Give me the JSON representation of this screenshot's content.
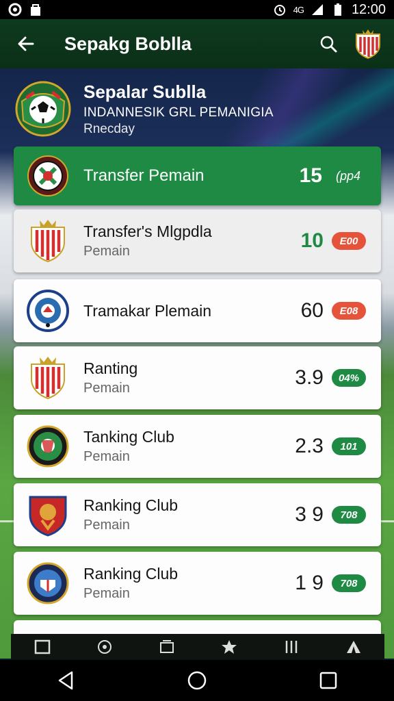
{
  "status_bar": {
    "time": "12:00",
    "network_label": "4G"
  },
  "app_bar": {
    "title": "Sepakg Boblla",
    "back_icon": "arrow-left-icon",
    "search_icon": "search-icon",
    "crest_icon": "club-crest-icon"
  },
  "league": {
    "name": "Sepalar Sublla",
    "subtitle": "INDANNESIK GRL PEMANIGIA",
    "subtitle2": "Rnecday",
    "logo_icon": "league-ball-logo-icon"
  },
  "items": [
    {
      "title": "Transfer Pemain",
      "subtitle": "",
      "value": "15",
      "badge": "(pp4",
      "badge_style": "plain",
      "featured": true,
      "value_style": "white"
    },
    {
      "title": "Transfer's Mlgpdla",
      "subtitle": "Pemain",
      "value": "10",
      "badge": "E00",
      "badge_style": "red",
      "featured": false,
      "value_style": "green"
    },
    {
      "title": "Tramakar Plemain",
      "subtitle": "",
      "value": "60",
      "badge": "E08",
      "badge_style": "red",
      "featured": false,
      "value_style": "dark"
    },
    {
      "title": "Ranting",
      "subtitle": "Pemain",
      "value": "3.9",
      "badge": "04%",
      "badge_style": "green",
      "featured": false,
      "value_style": "dark"
    },
    {
      "title": "Tanking Club",
      "subtitle": "Pemain",
      "value": "2.3",
      "badge": "101",
      "badge_style": "green",
      "featured": false,
      "value_style": "dark"
    },
    {
      "title": "Ranking Club",
      "subtitle": "Pemain",
      "value": "3 9",
      "badge": "708",
      "badge_style": "green",
      "featured": false,
      "value_style": "dark"
    },
    {
      "title": "Ranking Club",
      "subtitle": "Pemain",
      "value": "1 9",
      "badge": "708",
      "badge_style": "green",
      "featured": false,
      "value_style": "dark"
    }
  ],
  "colors": {
    "accent_green": "#1e8a44",
    "badge_red": "#e5533b",
    "app_bar": "#0e3a1e"
  },
  "tabs": [
    {
      "icon": "square-tab-icon"
    },
    {
      "icon": "ball-tab-icon"
    },
    {
      "icon": "card-tab-icon"
    },
    {
      "icon": "star-tab-icon"
    },
    {
      "icon": "columns-tab-icon"
    },
    {
      "icon": "tent-tab-icon"
    }
  ],
  "nav": [
    {
      "icon": "back-triangle-icon"
    },
    {
      "icon": "home-circle-icon"
    },
    {
      "icon": "recents-square-icon"
    }
  ]
}
